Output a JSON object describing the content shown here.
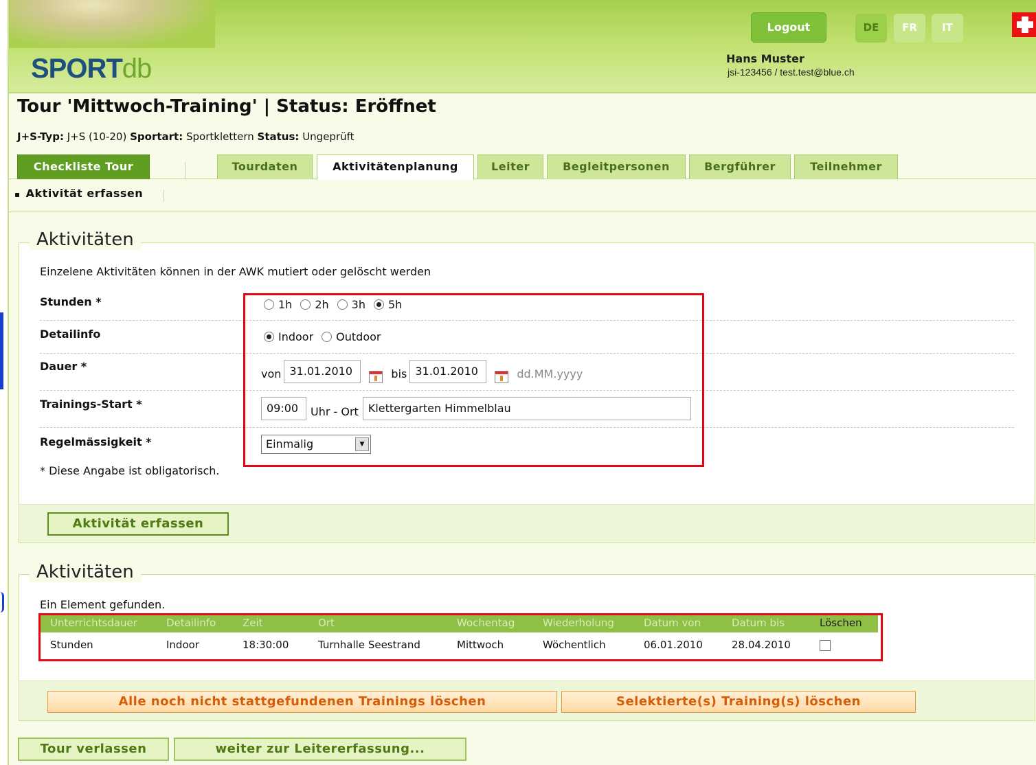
{
  "header": {
    "logo_main": "SPORT",
    "logo_sub": "db",
    "logout": "Logout",
    "languages": [
      "DE",
      "FR",
      "IT"
    ],
    "user_name": "Hans Muster",
    "user_info": "jsi-123456 / test.test@blue.ch"
  },
  "page": {
    "title": "Tour 'Mittwoch-Training' | Status: Eröffnet",
    "meta": [
      {
        "label": "J+S-Typ:",
        "value": "J+S (10-20)"
      },
      {
        "label": "Sportart:",
        "value": "Sportklettern"
      },
      {
        "label": "Status:",
        "value": "Ungeprüft"
      }
    ]
  },
  "tabs": {
    "checklist": "Checkliste Tour",
    "items": [
      "Tourdaten",
      "Aktivitätenplanung",
      "Leiter",
      "Begleitpersonen",
      "Bergführer",
      "Teilnehmer"
    ]
  },
  "subnav": {
    "item": "Aktivität erfassen"
  },
  "form": {
    "legend": "Aktivitäten",
    "intro": "Einzelene Aktivitäten können in der AWK mutiert oder gelöscht werden",
    "stunden_label": "Stunden *",
    "stunden_options": [
      "1h",
      "2h",
      "3h",
      "5h"
    ],
    "detail_label": "Detailinfo",
    "detail_options": [
      "Indoor",
      "Outdoor"
    ],
    "dauer_label": "Dauer *",
    "von": "von",
    "von_value": "31.01.2010",
    "bis": "bis",
    "bis_value": "31.01.2010",
    "date_hint": "dd.MM.yyyy",
    "start_label": "Trainings-Start *",
    "start_value": "09:00",
    "uhr_ort": "Uhr - Ort",
    "ort_value": "Klettergarten Himmelblau",
    "regel_label": "Regelmässigkeit *",
    "regel_value": "Einmalig",
    "oblig": "* Diese Angabe ist obligatorisch.",
    "submit": "Aktivität erfassen"
  },
  "list": {
    "legend": "Aktivitäten",
    "found": "Ein Element gefunden.",
    "columns": [
      "Unterrichtsdauer",
      "Detailinfo",
      "Zeit",
      "Ort",
      "Wochentag",
      "Wiederholung",
      "Datum von",
      "Datum bis",
      "Löschen"
    ],
    "rows": [
      [
        "Stunden",
        "Indoor",
        "18:30:00",
        "Turnhalle Seestrand",
        "Mittwoch",
        "Wöchentlich",
        "06.01.2010",
        "28.04.2010"
      ]
    ],
    "delete_all": "Alle noch nicht stattgefundenen Trainings löschen",
    "delete_selected": "Selektierte(s) Training(s) löschen"
  },
  "footer": {
    "leave": "Tour verlassen",
    "next": "weiter zur Leitererfassung..."
  },
  "colors": {
    "accent": "#5f9e21",
    "highlight": "#e30613",
    "danger": "#d75c07"
  }
}
